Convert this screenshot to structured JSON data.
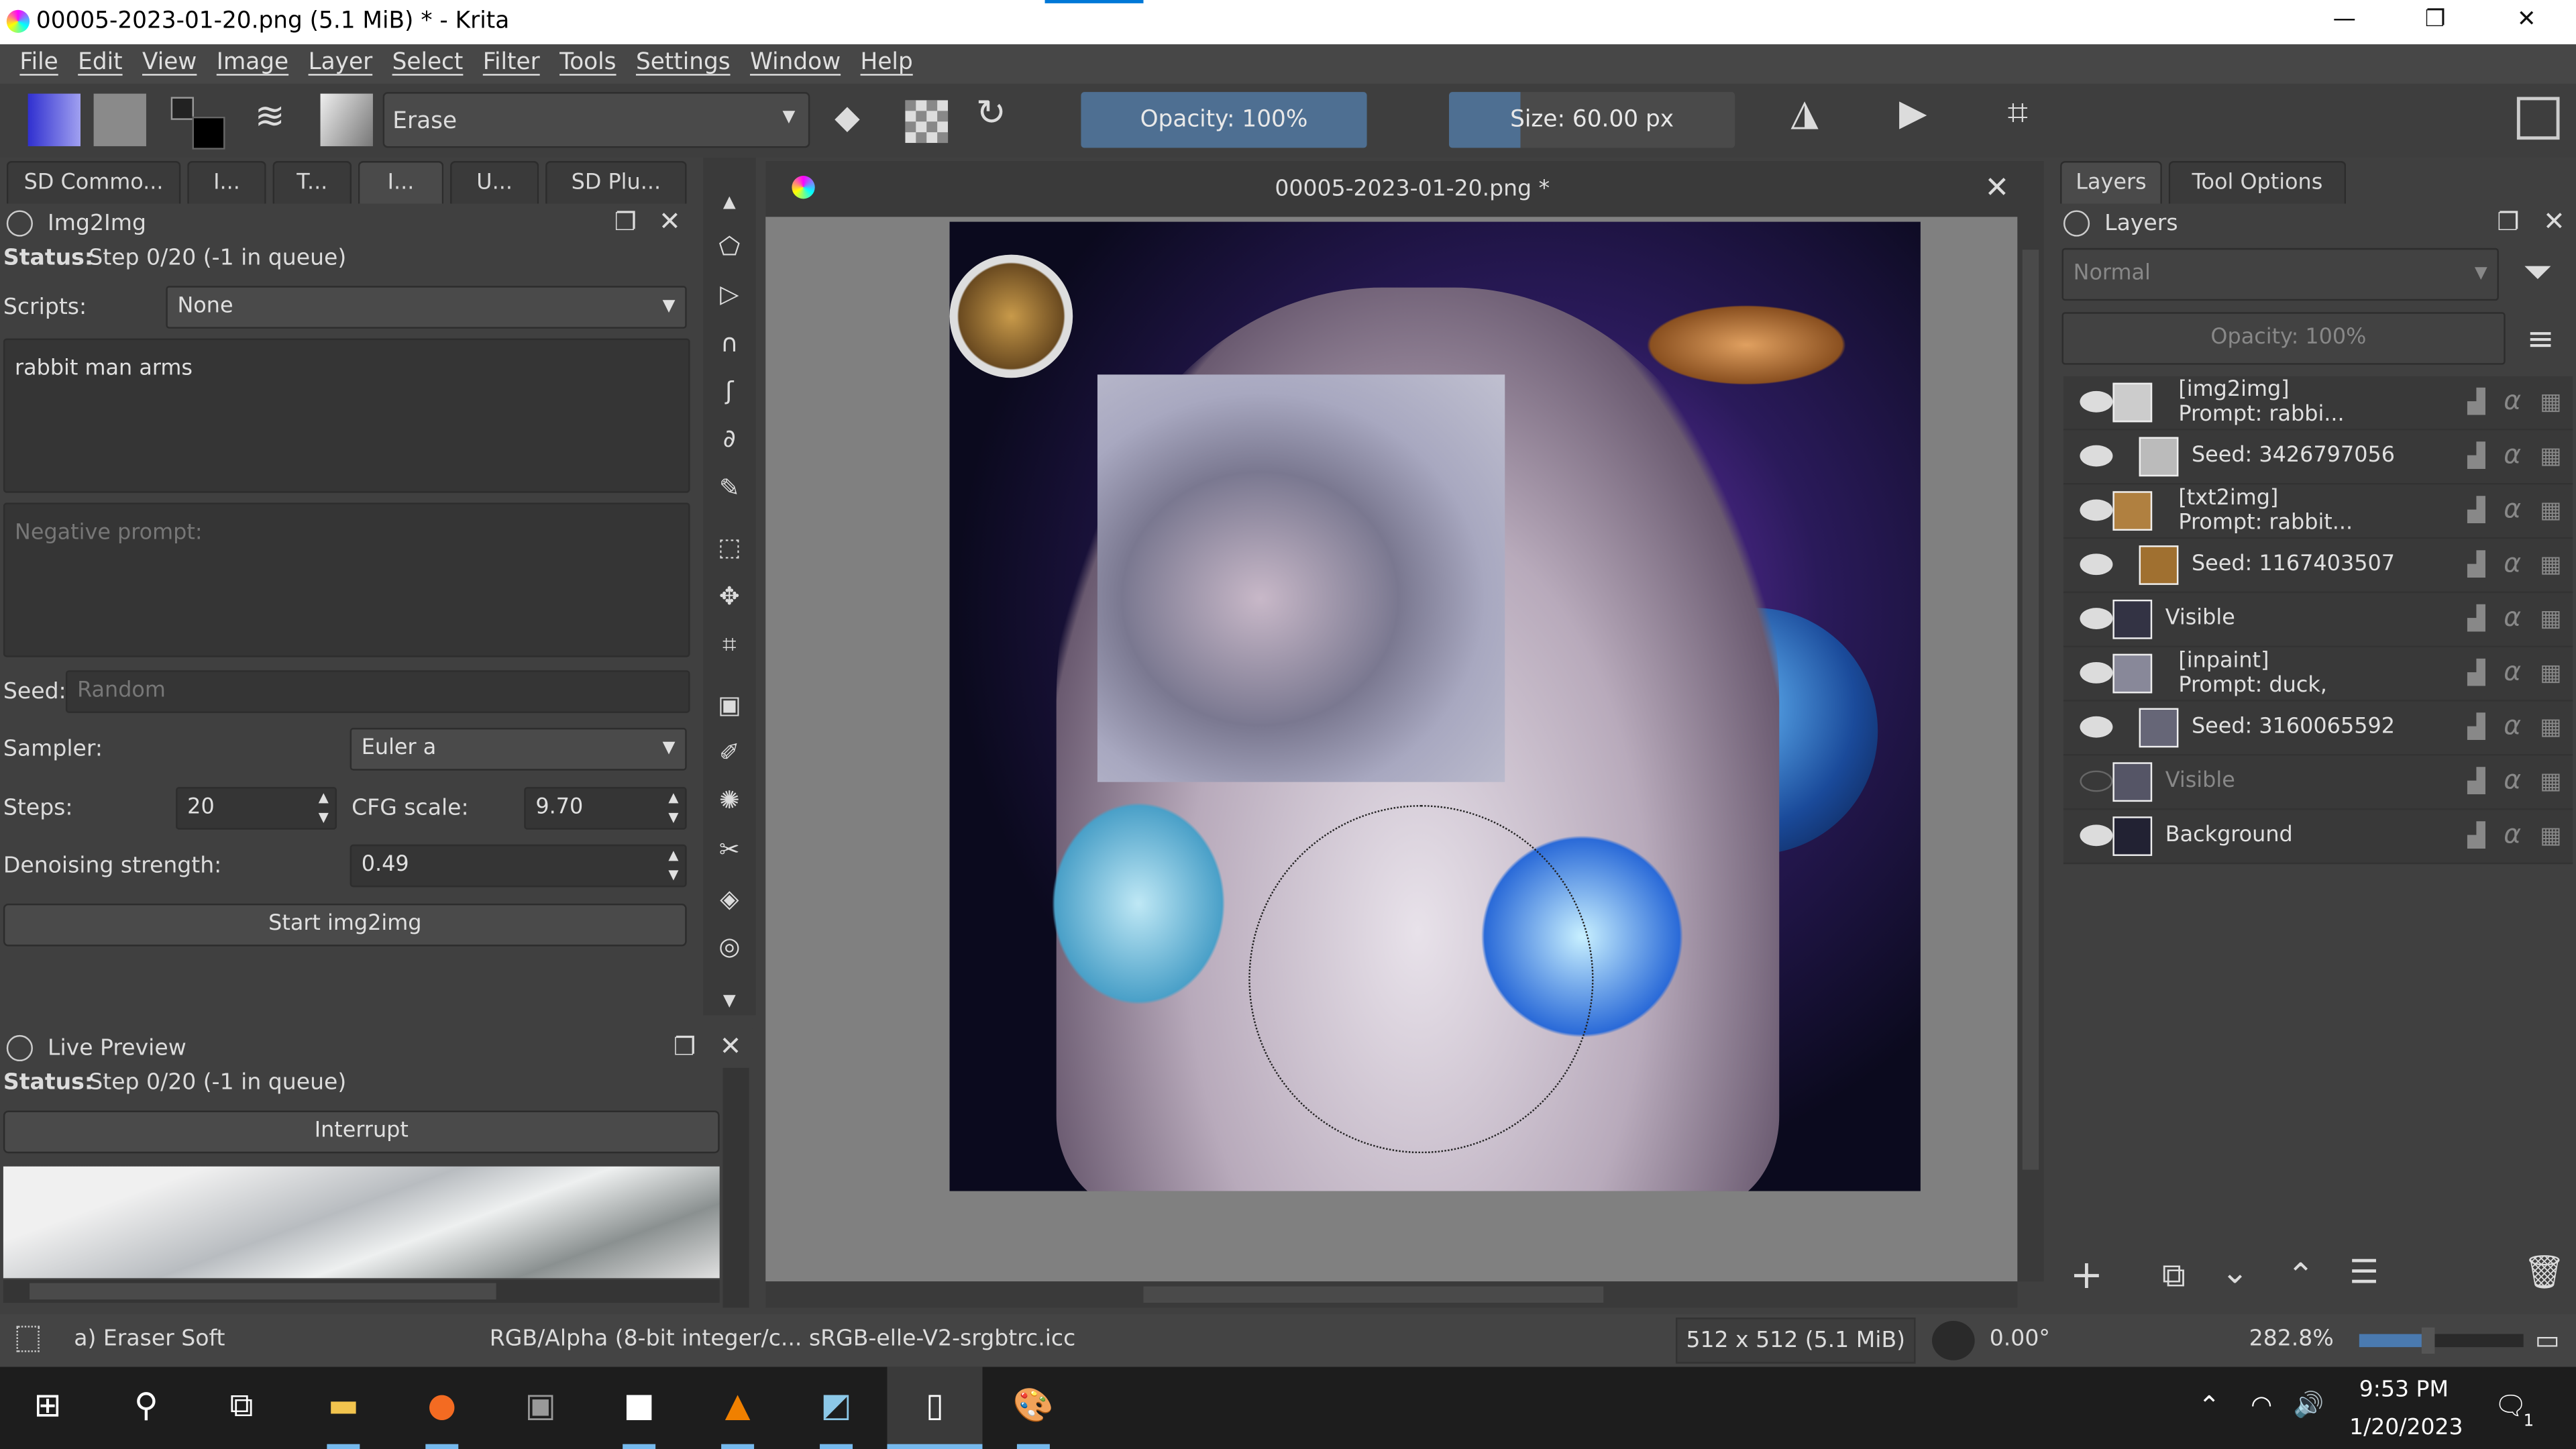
{
  "window": {
    "title": "00005-2023-01-20.png (5.1 MiB)  * - Krita",
    "minimize": "—",
    "restore": "❐",
    "close": "✕"
  },
  "menu": [
    "File",
    "Edit",
    "View",
    "Image",
    "Layer",
    "Select",
    "Filter",
    "Tools",
    "Settings",
    "Window",
    "Help"
  ],
  "toolbar": {
    "brush_preset": "Erase",
    "opacity": "Opacity: 100%",
    "size": "Size: 60.00 px"
  },
  "left_tabs": [
    "SD Commo...",
    "I...",
    "T...",
    "I...",
    "U...",
    "SD Plu..."
  ],
  "img2img": {
    "title": "Img2Img",
    "status_label": "Status:",
    "status": "Step 0/20 (-1 in queue)",
    "scripts_label": "Scripts:",
    "scripts": "None",
    "prompt": "rabbit man arms",
    "negative_placeholder": "Negative prompt:",
    "seed_label": "Seed:",
    "seed_placeholder": "Random",
    "sampler_label": "Sampler:",
    "sampler": "Euler a",
    "steps_label": "Steps:",
    "steps": "20",
    "cfg_label": "CFG scale:",
    "cfg": "9.70",
    "denoise_label": "Denoising strength:",
    "denoise": "0.49",
    "start": "Start img2img"
  },
  "live_preview": {
    "title": "Live Preview",
    "status_label": "Status:",
    "status": "Step 0/20 (-1 in queue)",
    "interrupt": "Interrupt"
  },
  "canvas": {
    "tab_title": "00005-2023-01-20.png *"
  },
  "right_tabs": [
    "Layers",
    "Tool Options"
  ],
  "layers": {
    "title": "Layers",
    "blend": "Normal",
    "opacity": "Opacity:  100%",
    "items": [
      {
        "name": "[img2img]",
        "sub": "Prompt: rabbi...",
        "visible": true,
        "group": true,
        "indent": 0
      },
      {
        "name": "Seed: 3426797056",
        "visible": true,
        "group": false,
        "indent": 1
      },
      {
        "name": "[txt2img]",
        "sub": "Prompt: rabbit...",
        "visible": true,
        "group": true,
        "indent": 0
      },
      {
        "name": "Seed: 1167403507",
        "visible": true,
        "group": false,
        "indent": 1
      },
      {
        "name": "Visible",
        "visible": true,
        "group": false,
        "indent": 0
      },
      {
        "name": "[inpaint]",
        "sub": "Prompt: duck,",
        "visible": true,
        "group": true,
        "indent": 0
      },
      {
        "name": "Seed: 3160065592",
        "visible": true,
        "group": false,
        "indent": 1
      },
      {
        "name": "Visible",
        "visible": false,
        "group": false,
        "indent": 0
      },
      {
        "name": "Background",
        "visible": true,
        "group": false,
        "indent": 0
      }
    ]
  },
  "status": {
    "brush": "a) Eraser Soft",
    "color": "RGB/Alpha (8-bit integer/c...  sRGB-elle-V2-srgbtrc.icc",
    "dims": "512 x 512 (5.1 MiB)",
    "rotation": "0.00°",
    "zoom": "282.8%"
  },
  "taskbar": {
    "time": "9:53 PM",
    "date": "1/20/2023",
    "notif": "1"
  }
}
